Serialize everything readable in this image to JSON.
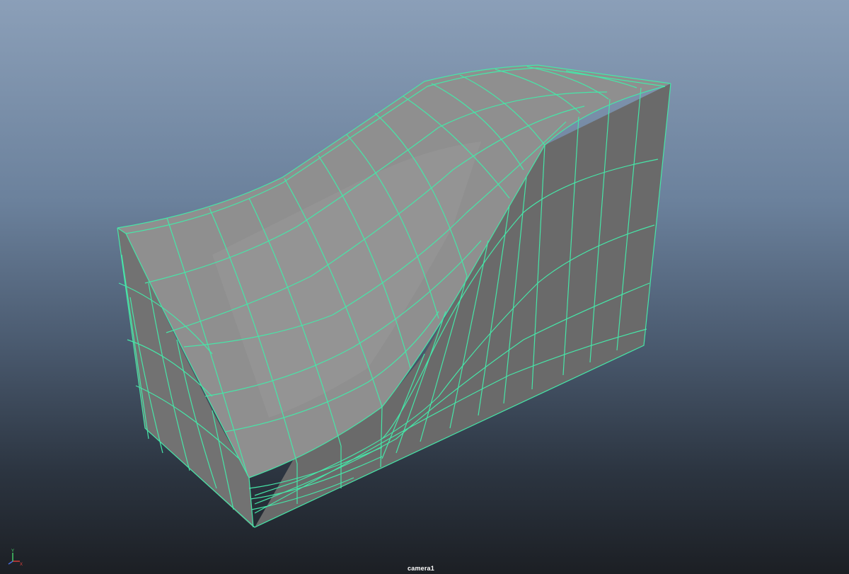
{
  "viewport": {
    "camera_label": "camera1",
    "background_top": "#8b9fb8",
    "background_bottom": "#1c1f24"
  },
  "mesh": {
    "wireframe_color": "#46e6a8",
    "top_face_color": "#8e8e8e",
    "side_face_color": "#6e6e6e",
    "front_face_color": "#767676"
  },
  "axis_gizmo": {
    "x_label": "X",
    "y_label": "Y",
    "x_color": "#e0403a",
    "y_color": "#46d66a",
    "z_color": "#4a70e0"
  }
}
